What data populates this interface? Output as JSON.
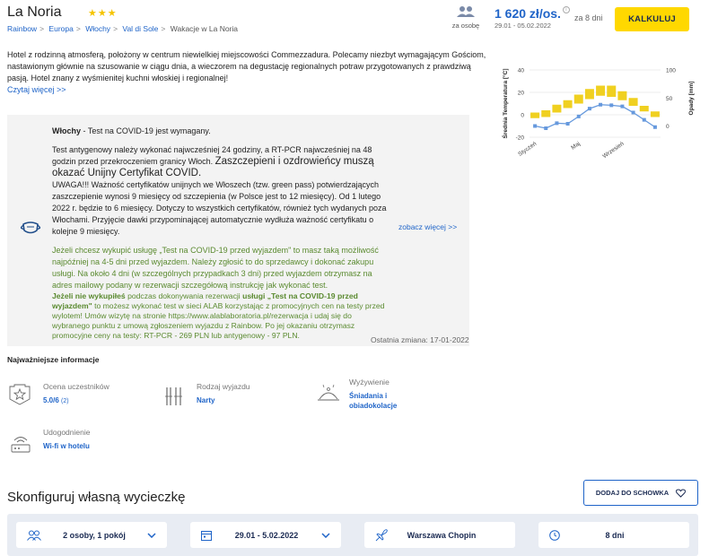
{
  "header": {
    "hotel_name": "La Noria",
    "stars": "★★★",
    "breadcrumb": [
      "Rainbow",
      "Europa",
      "Włochy",
      "Val di Sole",
      "Wakacje w La Noria"
    ],
    "per_person_label": "za osobę",
    "price": "1 620 zł/os.",
    "price_info": "i",
    "dates_small": "29.01 - 05.02.2022",
    "days_label": "za 8 dni",
    "calc_button": "KALKULUJ"
  },
  "description": {
    "text": "Hotel z rodzinną atmosferą, położony w centrum niewielkiej miejscowości Commezzadura. Polecamy niezbyt wymagającym Gościom, nastawionym głównie na szusowanie w ciągu dnia, a wieczorem na degustację regionalnych potraw przygotowanych z prawdziwą pasją. Hotel znany z wyśmienitej kuchni włoskiej i regionalnej!",
    "read_more": "Czytaj więcej >>"
  },
  "covid": {
    "country": "Włochy",
    "headline_rest": " - Test na COVID-19 jest wymagany.",
    "p1": "Test antygenowy należy wykonać najwcześniej 24 godziny, a RT-PCR najwcześniej na 48 godzin przed przekroczeniem granicy Włoch.",
    "p1_big": "Zaszczepieni i ozdrowieńcy muszą okazać Unijny Certyfikat COVID.",
    "p2": "UWAGA!!! Ważność certyfikatów unijnych we Włoszech (tzw. green pass) potwierdzających zaszczepienie wynosi 9 miesięcy od szczepienia (w Polsce jest to 12 miesięcy). Od 1 lutego 2022 r. będzie to 6 miesięcy. Dotyczy to wszystkich certyfikatów, również tych wydanych poza Włochami. Przyjęcie dawki przypominającej automatycznie wydłuża ważność certyfikatu o kolejne 9 miesięcy.",
    "g1": "Jeżeli chcesz wykupić usługę „Test na COVID-19 przed wyjazdem\" to masz taką możliwość najpóźniej na 4-5 dni przed wyjazdem. Należy zgłosić to do sprzedawcy i dokonać zakupu usługi. Na około 4 dni (w szczególnych przypadkach 3 dni) przed wyjazdem otrzymasz na adres mailowy podany w rezerwacji szczegółową instrukcję jak wykonać test.",
    "g2_bold": "Jeżeli nie wykupiłeś",
    "g2_mid": " podczas dokonywania rezerwacji ",
    "g2_bold2": "usługi „Test na COVID-19 przed wyjazdem\"",
    "g2_rest": " to możesz wykonać test w sieci ALAB korzystając z promocyjnych cen na testy przed wylotem! Umów wizytę na stronie https://www.alablaboratoria.pl/rezerwacja i udaj się do wybranego punktu z umową zgłoszeniem wyjazdu z Rainbow. Po jej okazaniu otrzymasz promocyjne ceny na testy: RT-PCR - 269 PLN lub antygenowy - 97 PLN.",
    "see_more": "zobacz więcej >>",
    "last_change": "Ostatnia zmiana: 17-01-2022"
  },
  "info": {
    "title": "Najważniejsze informacje",
    "rating_label": "Ocena uczestników",
    "rating_value": "5.0/6",
    "rating_count": "(2)",
    "trip_type_label": "Rodzaj wyjazdu",
    "trip_type_value": "Narty",
    "food_label": "Wyżywienie",
    "food_value": "Śniadania i obiadokolacje",
    "facility_label": "Udogodnienie",
    "facility_value": "Wi-fi w hotelu"
  },
  "configure": {
    "title": "Skonfiguruj własną wycieczkę",
    "save_button": "DODAJ DO SCHOWKA",
    "guests": "2 osoby, 1 pokój",
    "dates": "29.01 - 5.02.2022",
    "airport": "Warszawa Chopin",
    "duration": "8 dni"
  },
  "colors": {
    "accent": "#1f64c8",
    "button": "#ffd800",
    "covid_green": "#5a8a2f",
    "bar": "#f0d020",
    "line": "#6699dd"
  },
  "chart_data": {
    "type": "bar+line",
    "ylabel": "Średnia Temperatura [°C]",
    "y2label": "Opady [mm]",
    "ylim": [
      -20,
      40
    ],
    "y2lim": [
      -20,
      100
    ],
    "yticks": [
      -20,
      0,
      20,
      40
    ],
    "y2ticks": [
      0,
      50,
      100
    ],
    "x_tick_labels": [
      "Styczeń",
      "Maj",
      "Wrzesień"
    ],
    "x_tick_months": [
      1,
      5,
      9
    ],
    "months": [
      1,
      2,
      3,
      4,
      5,
      6,
      7,
      8,
      9,
      10,
      11,
      12
    ],
    "series": [
      {
        "kind": "range_bar",
        "low": [
          -3,
          -2,
          2,
          6,
          10,
          14,
          17,
          16,
          13,
          8,
          3,
          -2
        ],
        "high": [
          2,
          4,
          9,
          13,
          18,
          23,
          26,
          26,
          21,
          15,
          8,
          3
        ]
      },
      {
        "kind": "line",
        "values": [
          0,
          -4,
          5,
          4,
          17,
          31,
          38,
          37,
          35,
          24,
          11,
          -2
        ]
      }
    ]
  }
}
